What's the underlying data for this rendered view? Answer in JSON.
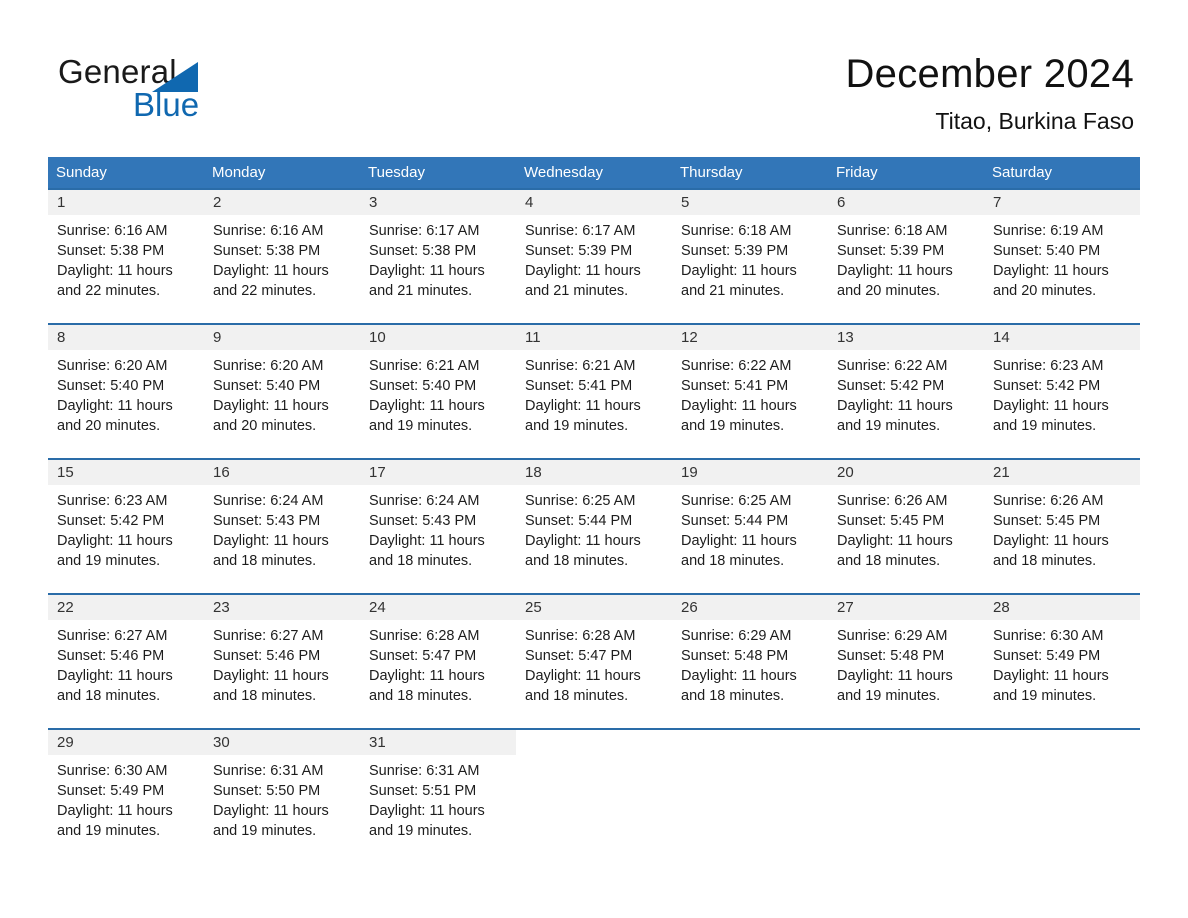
{
  "logo": {
    "word_one": "General",
    "word_two": "Blue",
    "triangle_color": "#1068b0"
  },
  "header": {
    "month_title": "December 2024",
    "location": "Titao, Burkina Faso"
  },
  "theme": {
    "header_blue": "#3276b8",
    "row_border_blue": "#2a6ca8",
    "date_band_gray": "#f1f1f1"
  },
  "calendar": {
    "weekdays": [
      "Sunday",
      "Monday",
      "Tuesday",
      "Wednesday",
      "Thursday",
      "Friday",
      "Saturday"
    ],
    "weeks": [
      [
        {
          "date": "1",
          "sunrise": "Sunrise: 6:16 AM",
          "sunset": "Sunset: 5:38 PM",
          "daylight_line1": "Daylight: 11 hours",
          "daylight_line2": "and 22 minutes."
        },
        {
          "date": "2",
          "sunrise": "Sunrise: 6:16 AM",
          "sunset": "Sunset: 5:38 PM",
          "daylight_line1": "Daylight: 11 hours",
          "daylight_line2": "and 22 minutes."
        },
        {
          "date": "3",
          "sunrise": "Sunrise: 6:17 AM",
          "sunset": "Sunset: 5:38 PM",
          "daylight_line1": "Daylight: 11 hours",
          "daylight_line2": "and 21 minutes."
        },
        {
          "date": "4",
          "sunrise": "Sunrise: 6:17 AM",
          "sunset": "Sunset: 5:39 PM",
          "daylight_line1": "Daylight: 11 hours",
          "daylight_line2": "and 21 minutes."
        },
        {
          "date": "5",
          "sunrise": "Sunrise: 6:18 AM",
          "sunset": "Sunset: 5:39 PM",
          "daylight_line1": "Daylight: 11 hours",
          "daylight_line2": "and 21 minutes."
        },
        {
          "date": "6",
          "sunrise": "Sunrise: 6:18 AM",
          "sunset": "Sunset: 5:39 PM",
          "daylight_line1": "Daylight: 11 hours",
          "daylight_line2": "and 20 minutes."
        },
        {
          "date": "7",
          "sunrise": "Sunrise: 6:19 AM",
          "sunset": "Sunset: 5:40 PM",
          "daylight_line1": "Daylight: 11 hours",
          "daylight_line2": "and 20 minutes."
        }
      ],
      [
        {
          "date": "8",
          "sunrise": "Sunrise: 6:20 AM",
          "sunset": "Sunset: 5:40 PM",
          "daylight_line1": "Daylight: 11 hours",
          "daylight_line2": "and 20 minutes."
        },
        {
          "date": "9",
          "sunrise": "Sunrise: 6:20 AM",
          "sunset": "Sunset: 5:40 PM",
          "daylight_line1": "Daylight: 11 hours",
          "daylight_line2": "and 20 minutes."
        },
        {
          "date": "10",
          "sunrise": "Sunrise: 6:21 AM",
          "sunset": "Sunset: 5:40 PM",
          "daylight_line1": "Daylight: 11 hours",
          "daylight_line2": "and 19 minutes."
        },
        {
          "date": "11",
          "sunrise": "Sunrise: 6:21 AM",
          "sunset": "Sunset: 5:41 PM",
          "daylight_line1": "Daylight: 11 hours",
          "daylight_line2": "and 19 minutes."
        },
        {
          "date": "12",
          "sunrise": "Sunrise: 6:22 AM",
          "sunset": "Sunset: 5:41 PM",
          "daylight_line1": "Daylight: 11 hours",
          "daylight_line2": "and 19 minutes."
        },
        {
          "date": "13",
          "sunrise": "Sunrise: 6:22 AM",
          "sunset": "Sunset: 5:42 PM",
          "daylight_line1": "Daylight: 11 hours",
          "daylight_line2": "and 19 minutes."
        },
        {
          "date": "14",
          "sunrise": "Sunrise: 6:23 AM",
          "sunset": "Sunset: 5:42 PM",
          "daylight_line1": "Daylight: 11 hours",
          "daylight_line2": "and 19 minutes."
        }
      ],
      [
        {
          "date": "15",
          "sunrise": "Sunrise: 6:23 AM",
          "sunset": "Sunset: 5:42 PM",
          "daylight_line1": "Daylight: 11 hours",
          "daylight_line2": "and 19 minutes."
        },
        {
          "date": "16",
          "sunrise": "Sunrise: 6:24 AM",
          "sunset": "Sunset: 5:43 PM",
          "daylight_line1": "Daylight: 11 hours",
          "daylight_line2": "and 18 minutes."
        },
        {
          "date": "17",
          "sunrise": "Sunrise: 6:24 AM",
          "sunset": "Sunset: 5:43 PM",
          "daylight_line1": "Daylight: 11 hours",
          "daylight_line2": "and 18 minutes."
        },
        {
          "date": "18",
          "sunrise": "Sunrise: 6:25 AM",
          "sunset": "Sunset: 5:44 PM",
          "daylight_line1": "Daylight: 11 hours",
          "daylight_line2": "and 18 minutes."
        },
        {
          "date": "19",
          "sunrise": "Sunrise: 6:25 AM",
          "sunset": "Sunset: 5:44 PM",
          "daylight_line1": "Daylight: 11 hours",
          "daylight_line2": "and 18 minutes."
        },
        {
          "date": "20",
          "sunrise": "Sunrise: 6:26 AM",
          "sunset": "Sunset: 5:45 PM",
          "daylight_line1": "Daylight: 11 hours",
          "daylight_line2": "and 18 minutes."
        },
        {
          "date": "21",
          "sunrise": "Sunrise: 6:26 AM",
          "sunset": "Sunset: 5:45 PM",
          "daylight_line1": "Daylight: 11 hours",
          "daylight_line2": "and 18 minutes."
        }
      ],
      [
        {
          "date": "22",
          "sunrise": "Sunrise: 6:27 AM",
          "sunset": "Sunset: 5:46 PM",
          "daylight_line1": "Daylight: 11 hours",
          "daylight_line2": "and 18 minutes."
        },
        {
          "date": "23",
          "sunrise": "Sunrise: 6:27 AM",
          "sunset": "Sunset: 5:46 PM",
          "daylight_line1": "Daylight: 11 hours",
          "daylight_line2": "and 18 minutes."
        },
        {
          "date": "24",
          "sunrise": "Sunrise: 6:28 AM",
          "sunset": "Sunset: 5:47 PM",
          "daylight_line1": "Daylight: 11 hours",
          "daylight_line2": "and 18 minutes."
        },
        {
          "date": "25",
          "sunrise": "Sunrise: 6:28 AM",
          "sunset": "Sunset: 5:47 PM",
          "daylight_line1": "Daylight: 11 hours",
          "daylight_line2": "and 18 minutes."
        },
        {
          "date": "26",
          "sunrise": "Sunrise: 6:29 AM",
          "sunset": "Sunset: 5:48 PM",
          "daylight_line1": "Daylight: 11 hours",
          "daylight_line2": "and 18 minutes."
        },
        {
          "date": "27",
          "sunrise": "Sunrise: 6:29 AM",
          "sunset": "Sunset: 5:48 PM",
          "daylight_line1": "Daylight: 11 hours",
          "daylight_line2": "and 19 minutes."
        },
        {
          "date": "28",
          "sunrise": "Sunrise: 6:30 AM",
          "sunset": "Sunset: 5:49 PM",
          "daylight_line1": "Daylight: 11 hours",
          "daylight_line2": "and 19 minutes."
        }
      ],
      [
        {
          "date": "29",
          "sunrise": "Sunrise: 6:30 AM",
          "sunset": "Sunset: 5:49 PM",
          "daylight_line1": "Daylight: 11 hours",
          "daylight_line2": "and 19 minutes."
        },
        {
          "date": "30",
          "sunrise": "Sunrise: 6:31 AM",
          "sunset": "Sunset: 5:50 PM",
          "daylight_line1": "Daylight: 11 hours",
          "daylight_line2": "and 19 minutes."
        },
        {
          "date": "31",
          "sunrise": "Sunrise: 6:31 AM",
          "sunset": "Sunset: 5:51 PM",
          "daylight_line1": "Daylight: 11 hours",
          "daylight_line2": "and 19 minutes."
        },
        {
          "date": "",
          "sunrise": "",
          "sunset": "",
          "daylight_line1": "",
          "daylight_line2": ""
        },
        {
          "date": "",
          "sunrise": "",
          "sunset": "",
          "daylight_line1": "",
          "daylight_line2": ""
        },
        {
          "date": "",
          "sunrise": "",
          "sunset": "",
          "daylight_line1": "",
          "daylight_line2": ""
        },
        {
          "date": "",
          "sunrise": "",
          "sunset": "",
          "daylight_line1": "",
          "daylight_line2": ""
        }
      ]
    ]
  }
}
